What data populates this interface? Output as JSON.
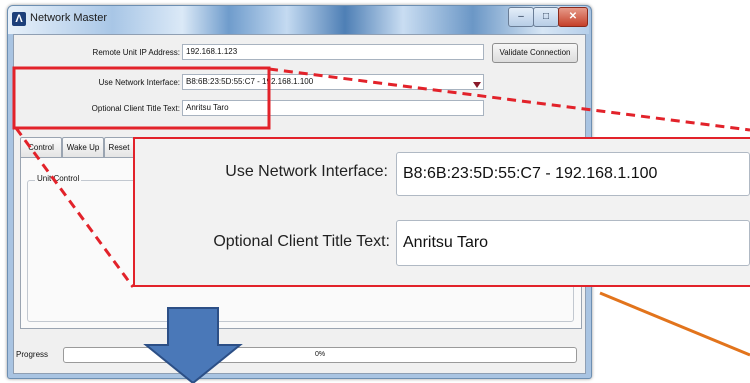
{
  "window": {
    "title": "Network Master",
    "logo_glyph": "Λ",
    "minimize_glyph": "–",
    "maximize_glyph": "□",
    "close_glyph": "✕"
  },
  "form": {
    "remote_ip_label": "Remote Unit IP Address:",
    "remote_ip_value": "192.168.1.123",
    "validate_button": "Validate Connection",
    "interface_label": "Use Network Interface:",
    "interface_value": "B8:6B:23:5D:55:C7 - 192.168.1.100",
    "client_title_label": "Optional Client Title Text:",
    "client_title_value": "Anritsu Taro"
  },
  "tabs": [
    {
      "label": "Control"
    },
    {
      "label": "Wake Up"
    },
    {
      "label": "Reset"
    }
  ],
  "unit_control": {
    "title": "Unit Control"
  },
  "progress": {
    "label": "Progress",
    "text": "0%",
    "value": 0
  },
  "zoom": {
    "interface_label": "Use Network Interface:",
    "interface_value": "B8:6B:23:5D:55:C7 - 192.168.1.100",
    "client_title_label": "Optional Client Title Text:",
    "client_title_value": "Anritsu Taro"
  },
  "colors": {
    "highlight": "#e2222a",
    "pointer_line": "#e2741c",
    "arrow_fill": "#4a78b8",
    "arrow_stroke": "#2c4f86"
  },
  "icons": {
    "dropdown": "dropdown-triangle-icon",
    "down_arrow": "down-arrow-icon",
    "logo": "app-logo-icon"
  }
}
